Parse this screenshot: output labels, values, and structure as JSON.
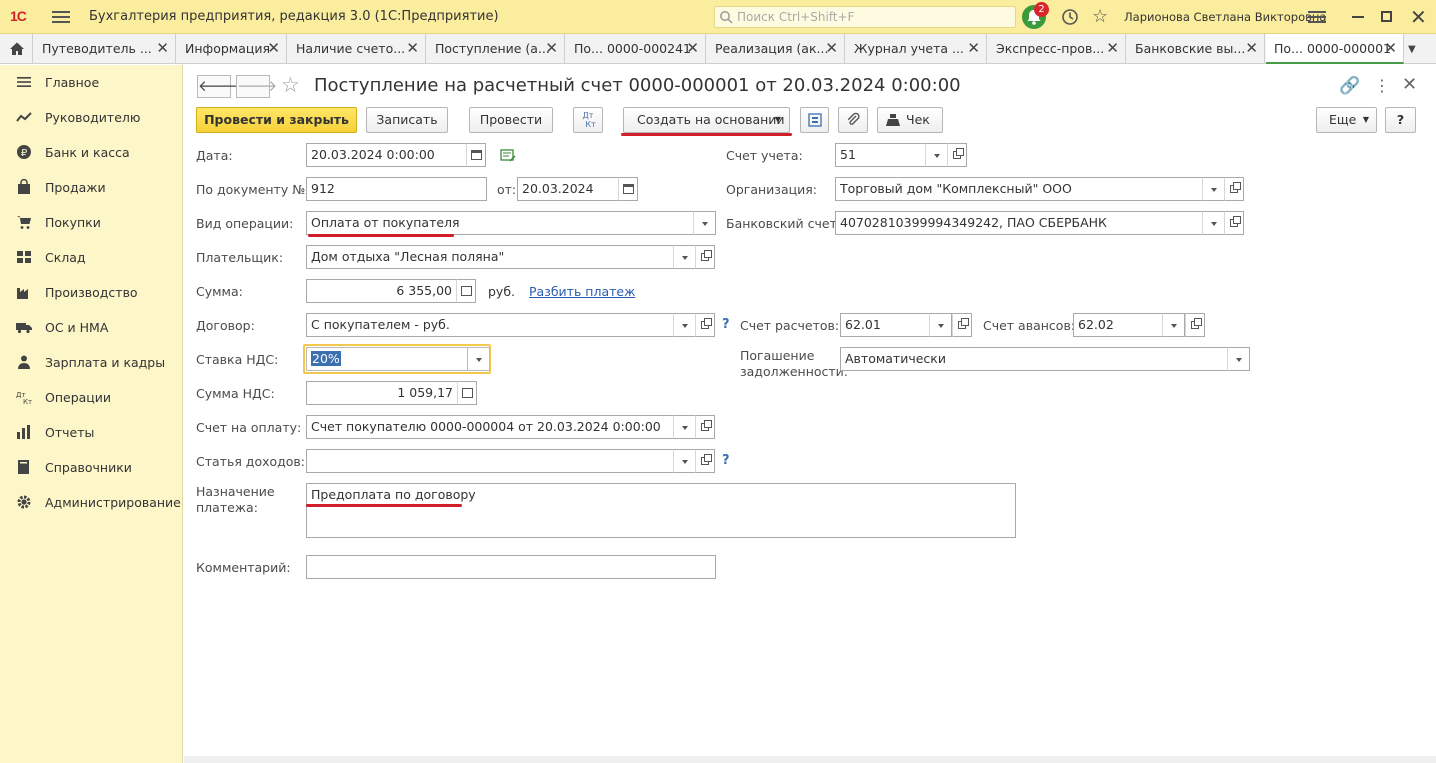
{
  "titlebar": {
    "logo": "1С",
    "app_title": "Бухгалтерия предприятия, редакция 3.0  (1С:Предприятие)",
    "search_placeholder": "Поиск Ctrl+Shift+F",
    "notifications": "2",
    "user": "Ларионова Светлана Викторовна"
  },
  "tabs": [
    {
      "label": "Путеводитель ..."
    },
    {
      "label": "Информация"
    },
    {
      "label": "Наличие счето..."
    },
    {
      "label": "Поступление (а..."
    },
    {
      "label": "По... 0000-000241"
    },
    {
      "label": "Реализация (ак..."
    },
    {
      "label": "Журнал учета ..."
    },
    {
      "label": "Экспресс-пров..."
    },
    {
      "label": "Банковские вы..."
    },
    {
      "label": "По... 0000-000001"
    }
  ],
  "sidebar": {
    "items": [
      {
        "label": "Главное",
        "icon": "menu-icon"
      },
      {
        "label": "Руководителю",
        "icon": "chart-line-icon"
      },
      {
        "label": "Банк и касса",
        "icon": "ruble-icon"
      },
      {
        "label": "Продажи",
        "icon": "bag-icon"
      },
      {
        "label": "Покупки",
        "icon": "cart-icon"
      },
      {
        "label": "Склад",
        "icon": "warehouse-icon"
      },
      {
        "label": "Производство",
        "icon": "factory-icon"
      },
      {
        "label": "ОС и НМА",
        "icon": "truck-icon"
      },
      {
        "label": "Зарплата и кадры",
        "icon": "person-icon"
      },
      {
        "label": "Операции",
        "icon": "dt-kt-icon"
      },
      {
        "label": "Отчеты",
        "icon": "bar-chart-icon"
      },
      {
        "label": "Справочники",
        "icon": "book-icon"
      },
      {
        "label": "Администрирование",
        "icon": "gear-icon"
      }
    ]
  },
  "form": {
    "title": "Поступление на расчетный счет 0000-000001 от 20.03.2024 0:00:00",
    "toolbar": {
      "post_close": "Провести и закрыть",
      "save": "Записать",
      "post": "Провести",
      "dtkt": "Дт Кт",
      "create_based": "Создать на основании",
      "receipt": "Чек",
      "more": "Еще",
      "help": "?"
    },
    "fields": {
      "date_label": "Дата:",
      "date_value": "20.03.2024  0:00:00",
      "doc_no_label": "По документу №:",
      "doc_no_value": "912",
      "from_label": "от:",
      "from_value": "20.03.2024",
      "op_type_label": "Вид операции:",
      "op_type_value": "Оплата от покупателя",
      "payer_label": "Плательщик:",
      "payer_value": "Дом отдыха \"Лесная поляна\"",
      "sum_label": "Сумма:",
      "sum_value": "6 355,00",
      "currency": "руб.",
      "split_link": "Разбить платеж",
      "contract_label": "Договор:",
      "contract_value": "С покупателем - руб.",
      "vat_rate_label": "Ставка НДС:",
      "vat_rate_value": "20%",
      "vat_sum_label": "Сумма НДС:",
      "vat_sum_value": "1 059,17",
      "invoice_label": "Счет на оплату:",
      "invoice_value": "Счет покупателю 0000-000004 от 20.03.2024 0:00:00",
      "income_label": "Статья доходов:",
      "income_value": "",
      "purpose_label_1": "Назначение",
      "purpose_label_2": "платежа:",
      "purpose_value": "Предоплата по договору",
      "comment_label": "Комментарий:",
      "comment_value": "",
      "account_label": "Счет учета:",
      "account_value": "51",
      "org_label": "Организация:",
      "org_value": "Торговый дом \"Комплексный\" ООО",
      "bank_label": "Банковский счет:",
      "bank_value": "40702810399994349242, ПАО СБЕРБАНК",
      "settle_label": "Счет расчетов:",
      "settle_value": "62.01",
      "advance_label": "Счет авансов:",
      "advance_value": "62.02",
      "debt_label_1": "Погашение",
      "debt_label_2": "задолженности:",
      "debt_value": "Автоматически"
    }
  },
  "colors": {
    "accent_yellow": "#fbed9e",
    "sidebar_bg": "#fcf6c8",
    "primary_button": "#f6d13a",
    "highlight_red": "#d11e28"
  }
}
